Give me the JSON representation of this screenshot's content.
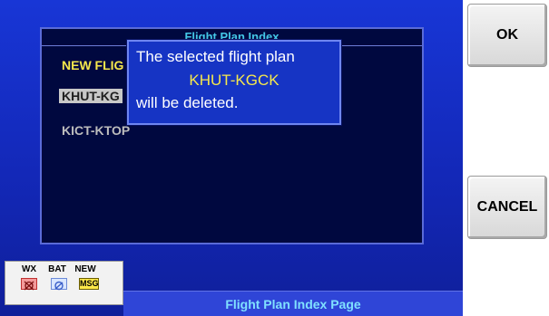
{
  "softkeys": {
    "ok_label": "OK",
    "cancel_label": "CANCEL"
  },
  "flight_plan_index": {
    "title": "Flight Plan Index",
    "items": [
      {
        "label": "NEW FLIG"
      },
      {
        "label": "KHUT-KG"
      },
      {
        "label": "KICT-KTOP"
      }
    ]
  },
  "dialog": {
    "line1": "The selected flight plan",
    "line2": "KHUT-KGCK",
    "line3": "will be deleted."
  },
  "status": {
    "wx_label": "WX",
    "bat_label": "BAT",
    "new_label": "NEW",
    "msg_label": "MSG"
  },
  "page_title": "Flight Plan Index Page",
  "colors": {
    "background": "#1836d6",
    "window": "#00083f",
    "highlight_text": "#f6e84c",
    "header_text": "#45c8e8"
  }
}
